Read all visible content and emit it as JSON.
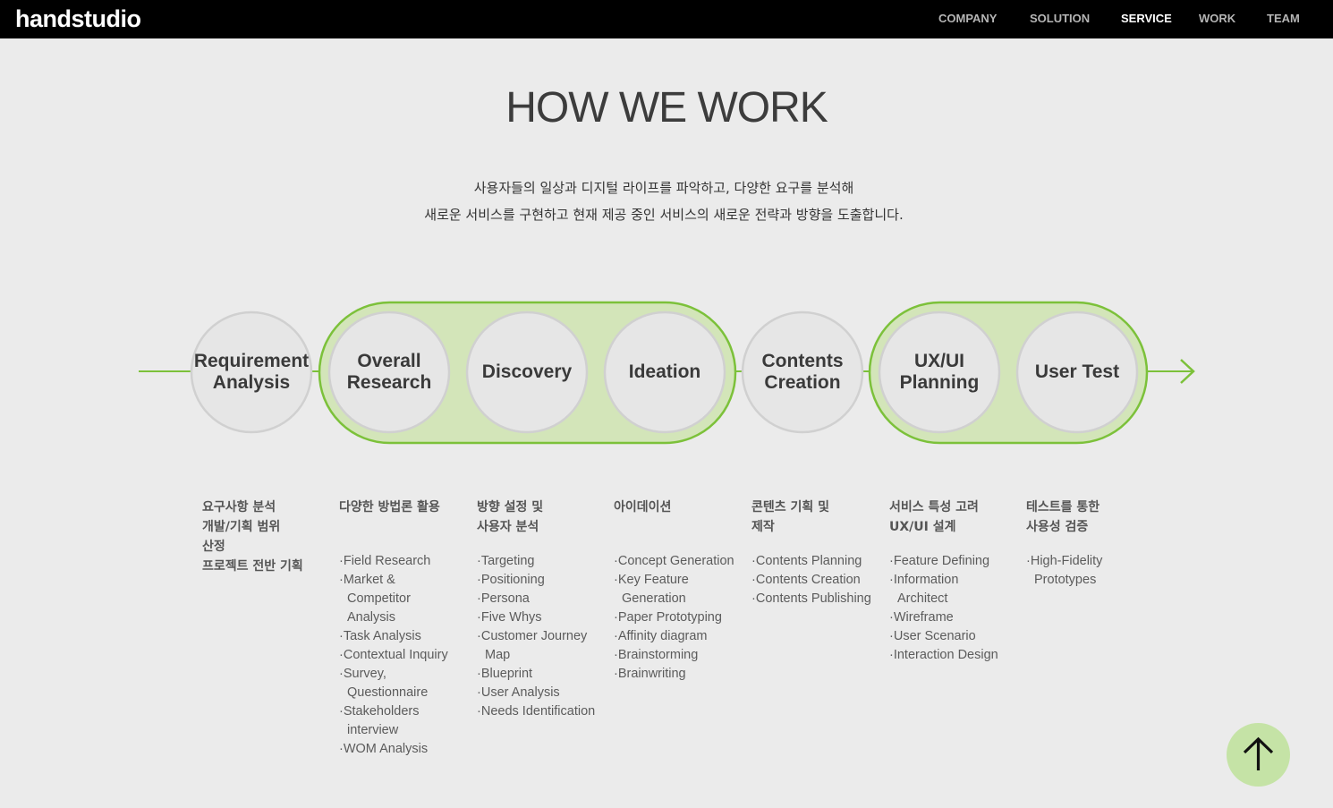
{
  "header": {
    "logo": "handstudio",
    "nav": [
      {
        "label": "COMPANY",
        "active": false
      },
      {
        "label": "SOLUTION",
        "active": false
      },
      {
        "label": "SERVICE",
        "active": true
      },
      {
        "label": "WORK",
        "active": false
      },
      {
        "label": "TEAM",
        "active": false
      }
    ]
  },
  "main": {
    "title": "HOW WE WORK",
    "intro_lines": [
      "사용자들의 일상과 디지털 라이프를 파악하고, 다양한 요구를 분석해",
      "새로운 서비스를 구현하고 현재 제공 중인 서비스의 새로운 전략과 방향을 도출합니다."
    ],
    "steps": [
      {
        "label": "Requirement Analysis",
        "label_lines": [
          "Requirement",
          "Analysis"
        ],
        "grouped": false,
        "heading": "요구사항 분석\n개발/기획 범위\n산정\n프로젝트 전반 기획",
        "items": []
      },
      {
        "label": "Overall Research",
        "label_lines": [
          "Overall",
          "Research"
        ],
        "grouped": true,
        "heading": "다양한 방법론 활용",
        "items": [
          "Field Research",
          "Market & Competitor Analysis",
          "Task Analysis",
          "Contextual Inquiry",
          "Survey, Questionnaire",
          "Stakeholders interview",
          "WOM Analysis"
        ]
      },
      {
        "label": "Discovery",
        "label_lines": [
          "Discovery"
        ],
        "grouped": true,
        "heading": "방향 설정 및\n사용자 분석",
        "items": [
          "Targeting",
          "Positioning",
          "Persona",
          "Five Whys",
          "Customer Journey Map",
          "Blueprint",
          "User Analysis",
          "Needs Identification"
        ]
      },
      {
        "label": "Ideation",
        "label_lines": [
          "Ideation"
        ],
        "grouped": true,
        "heading": "아이데이션",
        "items": [
          "Concept Generation",
          "Key Feature Generation",
          "Paper Prototyping",
          "Affinity diagram",
          "Brainstorming",
          "Brainwriting"
        ]
      },
      {
        "label": "Contents Creation",
        "label_lines": [
          "Contents",
          "Creation"
        ],
        "grouped": false,
        "heading": "콘텐츠 기획 및\n제작",
        "items": [
          "Contents Planning",
          "Contents Creation",
          "Contents Publishing"
        ]
      },
      {
        "label": "UX/UI Planning",
        "label_lines": [
          "UX/UI",
          "Planning"
        ],
        "grouped": true,
        "heading": "서비스 특성 고려\nUX/UI 설계",
        "items": [
          "Feature Defining",
          "Information Architect",
          "Wireframe",
          "User Scenario",
          "Interaction Design"
        ]
      },
      {
        "label": "User Test",
        "label_lines": [
          "User Test"
        ],
        "grouped": true,
        "heading": "테스트를 통한\n사용성 검증",
        "items": [
          "High-Fidelity Prototypes"
        ]
      }
    ]
  },
  "colors": {
    "accent_green": "#7cc13a",
    "group_fill": "#d3e5b9",
    "circle_fill": "#e6e6e6",
    "circle_stroke": "#d0d0d0",
    "top_button_fill": "#c5e3a6"
  },
  "icons": {
    "scroll_top": "arrow-up-icon",
    "flow_end": "arrow-right-icon"
  }
}
